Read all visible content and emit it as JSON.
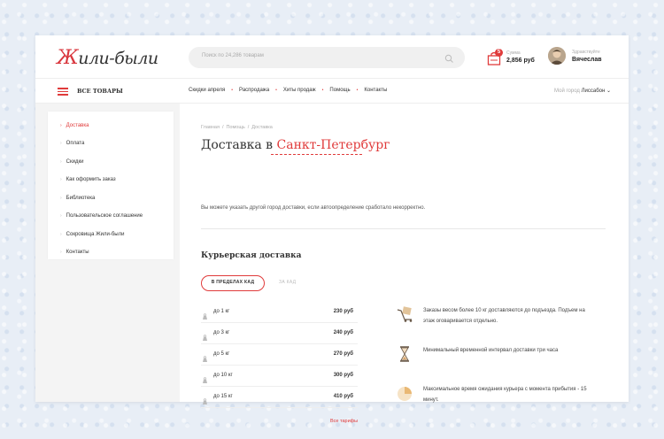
{
  "header": {
    "logo": "Жили-были",
    "search_placeholder": "Поиск по 24,286 товарам",
    "cart": {
      "badge": "5",
      "label": "Сумма",
      "sum": "2,856 руб"
    },
    "user": {
      "greeting": "Здравствуйте",
      "name": "Вячеслав"
    }
  },
  "nav": {
    "all_goods": "ВСЕ ТОВАРЫ",
    "links": [
      "Скидки апреля",
      "Распродажа",
      "Хиты продаж",
      "Помощь",
      "Контакты"
    ],
    "city_label": "Мой город",
    "city_value": "Лиссабон"
  },
  "sidebar": {
    "items": [
      "Доставка",
      "Оплата",
      "Скидки",
      "Как оформить заказ",
      "Библиотека",
      "Пользовательское соглашение",
      "Сокровища Жили-были",
      "Контакты"
    ]
  },
  "main": {
    "breadcrumbs": [
      "Главная",
      "Помощь",
      "Доставка"
    ],
    "title_prefix": "Доставка в",
    "title_city": "Санкт-Петербург",
    "hint": "Вы можете указать другой город доставки, если автоопределение сработало некорректно.",
    "section": "Курьерская доставка",
    "tabs": [
      "В ПРЕДЕЛАХ КАД",
      "ЗА КАД"
    ],
    "rates": [
      {
        "weight": "до 1 кг",
        "price": "230 руб"
      },
      {
        "weight": "до 3 кг",
        "price": "240 руб"
      },
      {
        "weight": "до 5 кг",
        "price": "270 руб"
      },
      {
        "weight": "до 10 кг",
        "price": "300 руб"
      },
      {
        "weight": "до 15 кг",
        "price": "410 руб"
      }
    ],
    "all_rates": "Все тарифы",
    "features": [
      {
        "icon": "cart-truck-icon",
        "text": "Заказы весом более 10 кг доставляются до подъезда. Подъем на этаж оговаривается отдельно."
      },
      {
        "icon": "hourglass-icon",
        "text": "Минимальный временной интервал доставки три часа"
      },
      {
        "icon": "clock-pie-icon",
        "text": "Максимальное время ожидания курьера с момента прибытия - 15 минут."
      }
    ]
  },
  "colors": {
    "accent": "#e03b3b",
    "page_bg": "#e8eef6"
  }
}
